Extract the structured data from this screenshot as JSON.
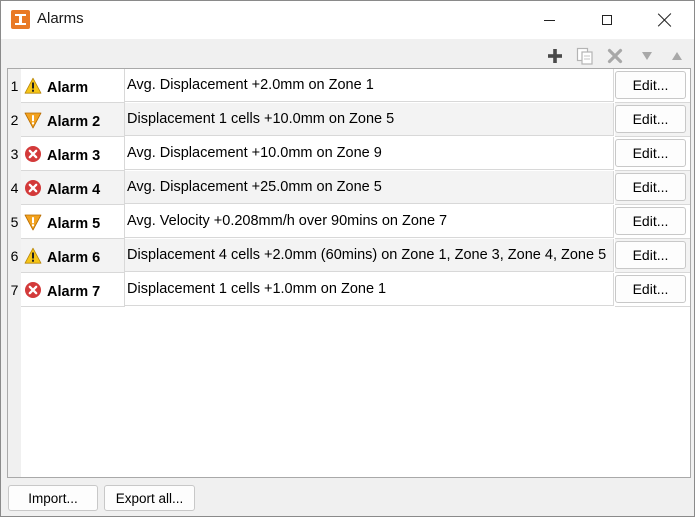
{
  "window": {
    "title": "Alarms"
  },
  "toolbar": {
    "icons": [
      "add-icon",
      "copy-icon",
      "delete-icon",
      "move-down-icon",
      "move-up-icon"
    ]
  },
  "colors": {
    "warning": "#f5c518",
    "danger_triangle": "#f2a21f",
    "error": "#d33a3a",
    "accent": "#e97a26"
  },
  "alarms": [
    {
      "index": "1",
      "name": "Alarm",
      "severity": "warning",
      "description": "Avg. Displacement +2.0mm on Zone 1",
      "edit_label": "Edit..."
    },
    {
      "index": "2",
      "name": "Alarm 2",
      "severity": "danger",
      "description": "Displacement 1 cells +10.0mm on Zone 5",
      "edit_label": "Edit..."
    },
    {
      "index": "3",
      "name": "Alarm 3",
      "severity": "error",
      "description": "Avg. Displacement +10.0mm on Zone 9",
      "edit_label": "Edit..."
    },
    {
      "index": "4",
      "name": "Alarm 4",
      "severity": "error",
      "description": "Avg. Displacement +25.0mm on Zone 5",
      "edit_label": "Edit..."
    },
    {
      "index": "5",
      "name": "Alarm 5",
      "severity": "danger",
      "description": "Avg. Velocity +0.208mm/h over 90mins on Zone 7",
      "edit_label": "Edit..."
    },
    {
      "index": "6",
      "name": "Alarm 6",
      "severity": "warning",
      "description": "Displacement 4 cells +2.0mm (60mins) on Zone 1, Zone 3, Zone 4, Zone 5",
      "edit_label": "Edit..."
    },
    {
      "index": "7",
      "name": "Alarm 7",
      "severity": "error",
      "description": "Displacement 1 cells +1.0mm on Zone 1",
      "edit_label": "Edit..."
    }
  ],
  "footer": {
    "import_label": "Import...",
    "export_label": "Export all..."
  }
}
